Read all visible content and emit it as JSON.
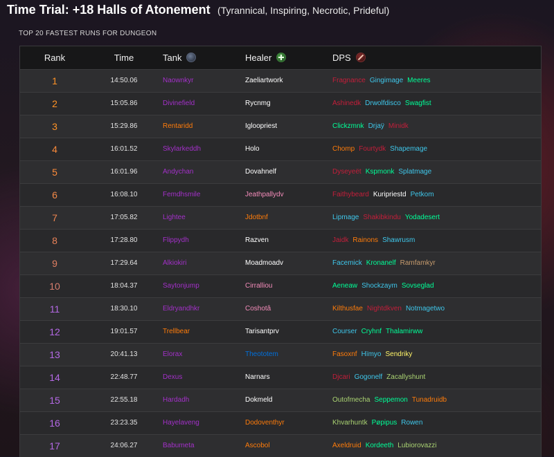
{
  "title": {
    "main": "Time Trial: +18 Halls of Atonement",
    "affixes": "(Tyrannical, Inspiring, Necrotic, Prideful)"
  },
  "subtitle": "TOP 20 FASTEST RUNS FOR DUNGEON",
  "header": {
    "rank": "Rank",
    "time": "Time",
    "tank": "Tank",
    "healer": "Healer",
    "dps": "DPS"
  },
  "icons": {
    "tank": "shield-icon",
    "healer": "plus-icon",
    "dps": "sword-icon"
  },
  "class_colors": {
    "dh": "#a330c9",
    "priest": "#ffffff",
    "monk": "#00ff98",
    "dk": "#c41e3a",
    "mage": "#3fc7eb",
    "shaman": "#0070dd",
    "warrior": "#c69b6d",
    "druid": "#ff7c0a",
    "paladin": "#f48cba",
    "rogue": "#fff468",
    "hunter": "#aad372"
  },
  "rank_colors": [
    "#ff9326",
    "#ff9326",
    "#ff9326",
    "#ff8c3a",
    "#ff8c3a",
    "#f58a48",
    "#f08650",
    "#e98258",
    "#e07f62",
    "#d77e6e",
    "#b569e6",
    "#b569e6",
    "#b569e6",
    "#b569e6",
    "#b569e6",
    "#b569e6",
    "#b569e6"
  ],
  "runs": [
    {
      "rank": "1",
      "time": "14:50.06",
      "tank": {
        "name": "Naownkyr",
        "cls": "dh"
      },
      "healer": {
        "name": "Zaeliartwork",
        "cls": "priest"
      },
      "dps": [
        {
          "name": "Fragnance",
          "cls": "dk"
        },
        {
          "name": "Gingimage",
          "cls": "mage"
        },
        {
          "name": "Meeres",
          "cls": "monk"
        }
      ]
    },
    {
      "rank": "2",
      "time": "15:05.86",
      "tank": {
        "name": "Divinefield",
        "cls": "dh"
      },
      "healer": {
        "name": "Rycnmg",
        "cls": "priest"
      },
      "dps": [
        {
          "name": "Ashinedk",
          "cls": "dk"
        },
        {
          "name": "Drwolfdisco",
          "cls": "mage"
        },
        {
          "name": "Swagfist",
          "cls": "monk"
        }
      ]
    },
    {
      "rank": "3",
      "time": "15:29.86",
      "tank": {
        "name": "Rentaridd",
        "cls": "druid"
      },
      "healer": {
        "name": "Igloopriest",
        "cls": "priest"
      },
      "dps": [
        {
          "name": "Clickzmnk",
          "cls": "monk"
        },
        {
          "name": "Drjaÿ",
          "cls": "mage"
        },
        {
          "name": "Minidk",
          "cls": "dk"
        }
      ]
    },
    {
      "rank": "4",
      "time": "16:01.52",
      "tank": {
        "name": "Skylarkeddh",
        "cls": "dh"
      },
      "healer": {
        "name": "Holo",
        "cls": "priest"
      },
      "dps": [
        {
          "name": "Chomp",
          "cls": "druid"
        },
        {
          "name": "Fourtydk",
          "cls": "dk"
        },
        {
          "name": "Shapemage",
          "cls": "mage"
        }
      ]
    },
    {
      "rank": "5",
      "time": "16:01.96",
      "tank": {
        "name": "Andychan",
        "cls": "dh"
      },
      "healer": {
        "name": "Dovahnelf",
        "cls": "priest"
      },
      "dps": [
        {
          "name": "Dyseyeët",
          "cls": "dk"
        },
        {
          "name": "Kspmonk",
          "cls": "monk"
        },
        {
          "name": "Splatmage",
          "cls": "mage"
        }
      ]
    },
    {
      "rank": "6",
      "time": "16:08.10",
      "tank": {
        "name": "Femdhsmile",
        "cls": "dh"
      },
      "healer": {
        "name": "Jeathpallydv",
        "cls": "paladin"
      },
      "dps": [
        {
          "name": "Faithybeard",
          "cls": "dk"
        },
        {
          "name": "Kuripriestd",
          "cls": "priest"
        },
        {
          "name": "Petkom",
          "cls": "mage"
        }
      ]
    },
    {
      "rank": "7",
      "time": "17:05.82",
      "tank": {
        "name": "Lightee",
        "cls": "dh"
      },
      "healer": {
        "name": "Jdotbnf",
        "cls": "druid"
      },
      "dps": [
        {
          "name": "Lipmage",
          "cls": "mage"
        },
        {
          "name": "Shakibkindu",
          "cls": "dk"
        },
        {
          "name": "Yodadesert",
          "cls": "monk"
        }
      ]
    },
    {
      "rank": "8",
      "time": "17:28.80",
      "tank": {
        "name": "Flippydh",
        "cls": "dh"
      },
      "healer": {
        "name": "Razven",
        "cls": "priest"
      },
      "dps": [
        {
          "name": "Jaidk",
          "cls": "dk"
        },
        {
          "name": "Rainons",
          "cls": "druid"
        },
        {
          "name": "Shawrusm",
          "cls": "mage"
        }
      ]
    },
    {
      "rank": "9",
      "time": "17:29.64",
      "tank": {
        "name": "Alkiokiri",
        "cls": "dh"
      },
      "healer": {
        "name": "Moadmoadv",
        "cls": "priest"
      },
      "dps": [
        {
          "name": "Facemick",
          "cls": "mage"
        },
        {
          "name": "Kronanelf",
          "cls": "monk"
        },
        {
          "name": "Ramfamkyr",
          "cls": "warrior"
        }
      ]
    },
    {
      "rank": "10",
      "time": "18:04.37",
      "tank": {
        "name": "Saytonjump",
        "cls": "dh"
      },
      "healer": {
        "name": "Cirralliou",
        "cls": "paladin"
      },
      "dps": [
        {
          "name": "Aeneaw",
          "cls": "monk"
        },
        {
          "name": "Shockzaym",
          "cls": "mage"
        },
        {
          "name": "Sovseglad",
          "cls": "monk"
        }
      ]
    },
    {
      "rank": "11",
      "time": "18:30.10",
      "tank": {
        "name": "Eldryandhkr",
        "cls": "dh"
      },
      "healer": {
        "name": "Coshotâ",
        "cls": "paladin"
      },
      "dps": [
        {
          "name": "Kilthusfae",
          "cls": "druid"
        },
        {
          "name": "Nightdkven",
          "cls": "dk"
        },
        {
          "name": "Notmagetwo",
          "cls": "mage"
        }
      ]
    },
    {
      "rank": "12",
      "time": "19:01.57",
      "tank": {
        "name": "Trellbear",
        "cls": "druid"
      },
      "healer": {
        "name": "Tarisantprv",
        "cls": "priest"
      },
      "dps": [
        {
          "name": "Courser",
          "cls": "mage"
        },
        {
          "name": "Cryhnf",
          "cls": "monk"
        },
        {
          "name": "Thalamirww",
          "cls": "monk"
        }
      ]
    },
    {
      "rank": "13",
      "time": "20:41.13",
      "tank": {
        "name": "Elorax",
        "cls": "dh"
      },
      "healer": {
        "name": "Theototem",
        "cls": "shaman"
      },
      "dps": [
        {
          "name": "Fasoxnf",
          "cls": "druid"
        },
        {
          "name": "Hïmyo",
          "cls": "mage"
        },
        {
          "name": "Sendriky",
          "cls": "rogue"
        }
      ]
    },
    {
      "rank": "14",
      "time": "22:48.77",
      "tank": {
        "name": "Dexus",
        "cls": "dh"
      },
      "healer": {
        "name": "Narnars",
        "cls": "priest"
      },
      "dps": [
        {
          "name": "Djcari",
          "cls": "dk"
        },
        {
          "name": "Gogonelf",
          "cls": "mage"
        },
        {
          "name": "Zacallyshunt",
          "cls": "hunter"
        }
      ]
    },
    {
      "rank": "15",
      "time": "22:55.18",
      "tank": {
        "name": "Hardadh",
        "cls": "dh"
      },
      "healer": {
        "name": "Dokmeld",
        "cls": "priest"
      },
      "dps": [
        {
          "name": "Outofmecha",
          "cls": "hunter"
        },
        {
          "name": "Seppemon",
          "cls": "monk"
        },
        {
          "name": "Tunadruidb",
          "cls": "druid"
        }
      ]
    },
    {
      "rank": "16",
      "time": "23:23.35",
      "tank": {
        "name": "Hayelaveng",
        "cls": "dh"
      },
      "healer": {
        "name": "Dodoventhyr",
        "cls": "druid"
      },
      "dps": [
        {
          "name": "Khvarhuntk",
          "cls": "hunter"
        },
        {
          "name": "Pøpipus",
          "cls": "monk"
        },
        {
          "name": "Rowen",
          "cls": "mage"
        }
      ]
    },
    {
      "rank": "17",
      "time": "24:06.27",
      "tank": {
        "name": "Babumeta",
        "cls": "dh"
      },
      "healer": {
        "name": "Ascobol",
        "cls": "druid"
      },
      "dps": [
        {
          "name": "Axeldruid",
          "cls": "druid"
        },
        {
          "name": "Kordeeth",
          "cls": "monk"
        },
        {
          "name": "Lubiorovazzi",
          "cls": "hunter"
        }
      ]
    }
  ]
}
